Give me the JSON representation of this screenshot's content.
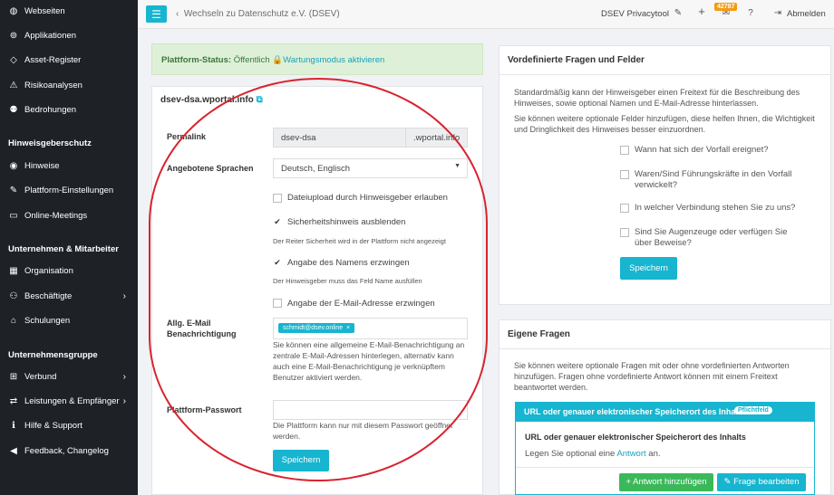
{
  "sidebar": {
    "items_top": [
      {
        "icon": "globe-icon",
        "label": "Webseiten",
        "glyph": "◍"
      },
      {
        "icon": "apps-icon",
        "label": "Applikationen",
        "glyph": "⊚"
      },
      {
        "icon": "diamond-icon",
        "label": "Asset-Register",
        "glyph": "◇"
      },
      {
        "icon": "warning-icon",
        "label": "Risikoanalysen",
        "glyph": "⚠"
      },
      {
        "icon": "bug-icon",
        "label": "Bedrohungen",
        "glyph": "⚉"
      }
    ],
    "section_hinweis": "Hinweisgeberschutz",
    "items_hinweis": [
      {
        "icon": "eye-icon",
        "label": "Hinweise",
        "glyph": "◉"
      },
      {
        "icon": "wrench-icon",
        "label": "Plattform-Einstellungen",
        "glyph": "✎"
      },
      {
        "icon": "video-icon",
        "label": "Online-Meetings",
        "glyph": "▭"
      }
    ],
    "section_unternehmen": "Unternehmen & Mitarbeiter",
    "items_unternehmen": [
      {
        "icon": "building-icon",
        "label": "Organisation",
        "glyph": "▦"
      },
      {
        "icon": "users-icon",
        "label": "Beschäftigte",
        "glyph": "⚇"
      },
      {
        "icon": "school-icon",
        "label": "Schulungen",
        "glyph": "⌂"
      }
    ],
    "section_gruppe": "Unternehmensgruppe",
    "items_gruppe": [
      {
        "icon": "network-icon",
        "label": "Verbund",
        "glyph": "⊞"
      },
      {
        "icon": "handshake-icon",
        "label": "Leistungen & Empfänger",
        "glyph": "⇄"
      },
      {
        "icon": "info-icon",
        "label": "Hilfe & Support",
        "glyph": "ℹ"
      },
      {
        "icon": "megaphone-icon",
        "label": "Feedback, Changelog",
        "glyph": "◀"
      }
    ]
  },
  "topbar": {
    "breadcrumb": "Wechseln zu Datenschutz e.V. (DSEV)",
    "tool_name": "DSEV Privacytool",
    "badge_count": "42787",
    "logout_label": "Abmelden"
  },
  "alert": {
    "prefix": "Plattform-Status:",
    "status": "Öffentlich",
    "link": "Wartungsmodus aktivieren"
  },
  "platform": {
    "domain": "dsev-dsa.wportal.info",
    "permalink_label": "Permalink",
    "permalink_value": "dsev-dsa",
    "permalink_suffix": ".wportal.info",
    "languages_label": "Angebotene Sprachen",
    "languages_value": "Deutsch, Englisch",
    "cb_upload": "Dateiupload durch Hinweisgeber erlauben",
    "cb_security": "Sicherheitshinweis ausblenden",
    "cb_security_help": "Der Reiter Sicherheit wird in der Plattform nicht angezeigt",
    "cb_name": "Angabe des Namens erzwingen",
    "cb_name_help": "Der Hinweisgeber muss das Feld Name ausfüllen",
    "cb_email": "Angabe der E-Mail-Adresse erzwingen",
    "email_label_1": "Allg. E-Mail",
    "email_label_2": "Benachrichtigung",
    "email_tag": "schmidt@dsev.online",
    "email_help": "Sie können eine allgemeine E-Mail-Benachrichtigung an zentrale E-Mail-Adressen hinterlegen, alternativ kann auch eine E-Mail-Benachrichtigung je verknüpftem Benutzer aktiviert werden.",
    "password_label": "Plattform-Passwort",
    "password_help": "Die Plattform kann nur mit diesem Passwort geöffnet werden.",
    "save": "Speichern"
  },
  "predefined": {
    "title": "Vordefinierte Fragen und Felder",
    "intro_1": "Standardmäßig kann der Hinweisgeber einen Freitext für die Beschreibung des Hinweises, sowie optional Namen und E-Mail-Adresse hinterlassen.",
    "intro_2": "Sie können weitere optionale Felder hinzufügen, diese helfen Ihnen, die Wichtigkeit und Dringlichkeit des Hinweises besser einzuordnen.",
    "q1": "Wann hat sich der Vorfall ereignet?",
    "q2": "Waren/Sind Führungskräfte in den Vorfall verwickelt?",
    "q3": "In welcher Verbindung stehen Sie zu uns?",
    "q4": "Sind Sie Augenzeuge oder verfügen Sie über Beweise?",
    "save": "Speichern"
  },
  "own": {
    "title": "Eigene Fragen",
    "intro": "Sie können weitere optionale Fragen mit oder ohne vordefinierten Antworten hinzufügen. Fragen ohne vordefinierte Antwort können mit einem Freitext beantwortet werden.",
    "q_header": "URL oder genauer elektronischer Speicherort des Inhalts",
    "q_badge": "Pflichtfeld",
    "q_title": "URL oder genauer elektronischer Speicherort des Inhalts",
    "q_hint_prefix": "Legen Sie optional eine",
    "q_hint_link": "Antwort",
    "q_hint_suffix": "an.",
    "add_answer": "+ Antwort hinzufügen",
    "edit_question": "Frage bearbeiten"
  },
  "colors": {
    "accent": "#17b5cf",
    "sidebar": "#1e2227",
    "success_bg": "#dff0d8",
    "annotation": "#d9232e"
  }
}
